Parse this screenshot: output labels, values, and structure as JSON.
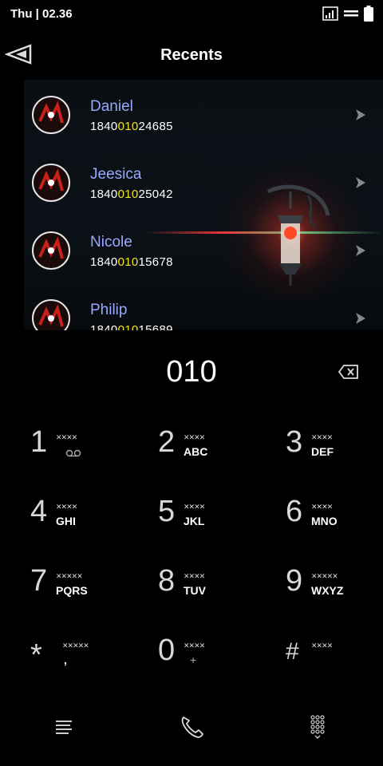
{
  "status": {
    "time": "Thu | 02.36"
  },
  "header": {
    "title": "Recents"
  },
  "contacts": [
    {
      "name": "Daniel",
      "num_pre": "1840",
      "num_hl": "010",
      "num_post": "24685"
    },
    {
      "name": "Jeesica",
      "num_pre": "1840",
      "num_hl": "010",
      "num_post": "25042"
    },
    {
      "name": "Nicole",
      "num_pre": "1840",
      "num_hl": "010",
      "num_post": "15678"
    },
    {
      "name": "Philip",
      "num_pre": "1840",
      "num_hl": "010",
      "num_post": "15689"
    }
  ],
  "dial": {
    "number": "010"
  },
  "keys": [
    {
      "digit": "1",
      "letters": ""
    },
    {
      "digit": "2",
      "letters": "ABC"
    },
    {
      "digit": "3",
      "letters": "DEF"
    },
    {
      "digit": "4",
      "letters": "GHI"
    },
    {
      "digit": "5",
      "letters": "JKL"
    },
    {
      "digit": "6",
      "letters": "MNO"
    },
    {
      "digit": "7",
      "letters": "PQRS"
    },
    {
      "digit": "8",
      "letters": "TUV"
    },
    {
      "digit": "9",
      "letters": "WXYZ"
    },
    {
      "digit": "*",
      "letters": ","
    },
    {
      "digit": "0",
      "letters": "+"
    },
    {
      "digit": "#",
      "letters": ""
    }
  ],
  "icons": {
    "back": "back-triangle-icon",
    "backspace": "backspace-icon",
    "menu": "menu-lines-icon",
    "call": "phone-icon",
    "keypad": "dialpad-icon"
  },
  "colors": {
    "name": "#9aa8ff",
    "highlight": "#f5e21c"
  }
}
